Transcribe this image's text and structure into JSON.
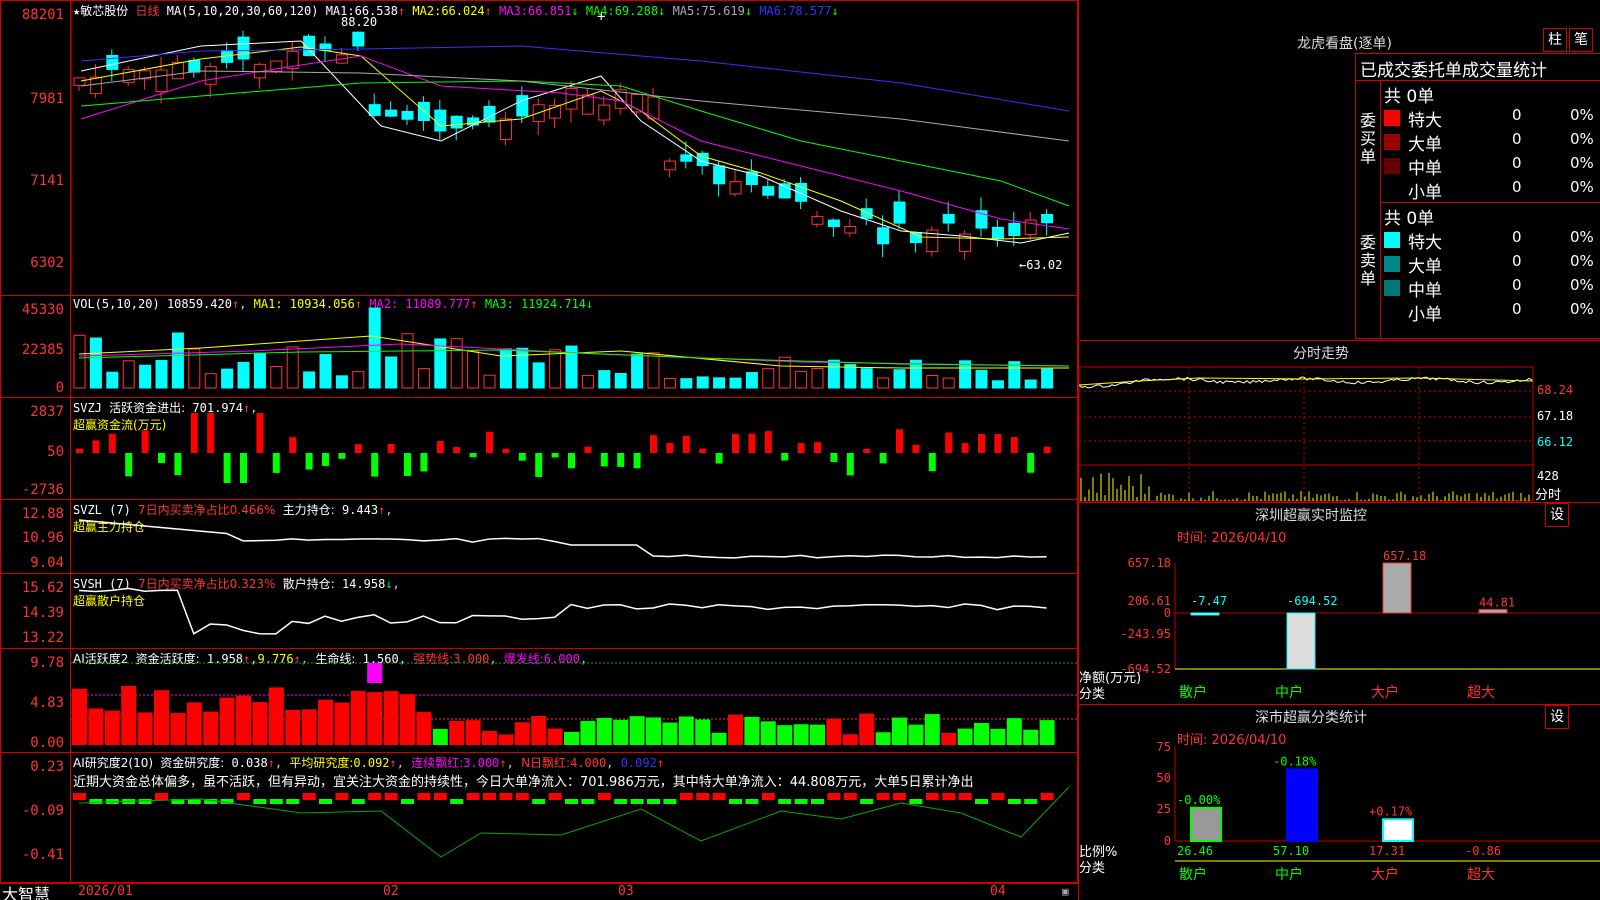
{
  "stock": {
    "star": "★",
    "name": "敏芯股份",
    "period": "日线",
    "ma_spec": "MA(5,10,20,30,60,120)",
    "ma": [
      {
        "k": "MA1:",
        "v": "66.538",
        "a": "↑",
        "c": "#fff"
      },
      {
        "k": "MA2:",
        "v": "66.024",
        "a": "↑",
        "c": "#ff0"
      },
      {
        "k": "MA3:",
        "v": "66.851",
        "a": "↓",
        "c": "#f0f"
      },
      {
        "k": "MA4:",
        "v": "69.288",
        "a": "↓",
        "c": "#0f0"
      },
      {
        "k": "MA5:",
        "v": "75.619",
        "a": "↓",
        "c": "#aaa"
      },
      {
        "k": "MA6:",
        "v": "78.577",
        "a": "↓",
        "c": "#33f"
      }
    ],
    "high_mark": "88.20",
    "low_mark": "←63.02"
  },
  "price_axis": [
    "88201",
    "7981",
    "7141",
    "6302"
  ],
  "vol": {
    "label": "VOL(5,10,20)",
    "val": "10859.420",
    "a": "↑",
    "ma": [
      {
        "k": "MA1:",
        "v": "10934.056",
        "a": "↑",
        "c": "#ff0"
      },
      {
        "k": "MA2:",
        "v": "11089.777",
        "a": "↑",
        "c": "#f0f"
      },
      {
        "k": "MA3:",
        "v": "11924.714",
        "a": "↓",
        "c": "#0f0"
      }
    ],
    "axis": [
      "45330",
      "22385",
      "0"
    ]
  },
  "svzj": {
    "label": "SVZJ",
    "title": "活跃资金进出:",
    "val": "701.974",
    "a": "↑",
    "sub": "超赢资金流(万元)",
    "axis": [
      "2837",
      "50",
      "-2736"
    ]
  },
  "svzl": {
    "label": "SVZL (7)",
    "t1": "7日内买卖净占比0.466%",
    "t2": "主力持仓:",
    "val": "9.443",
    "a": "↑",
    "sub": "超赢主力持仓",
    "axis": [
      "12.88",
      "10.96",
      "9.04"
    ]
  },
  "svsh": {
    "label": "SVSH (7)",
    "t1": "7日内买卖净占比0.323%",
    "t2": "散户持仓:",
    "val": "14.958",
    "a": "↓",
    "sub": "超赢散户持仓",
    "axis": [
      "15.62",
      "14.39",
      "13.22"
    ]
  },
  "ai1": {
    "label": "AI活跃度2",
    "t1": "资金活跃度:",
    "v1": "1.958",
    "v2": "9.776",
    "t3": "生命线:",
    "v3": "1.560",
    "t4": "强势线:",
    "v4": "3.000",
    "t5": "爆发线:",
    "v5": "6.000",
    "axis": [
      "9.78",
      "4.83",
      "0.00"
    ]
  },
  "ai2": {
    "label": "AI研究度2(10)",
    "t1": "资金研究度:",
    "v1": "0.038",
    "t2": "平均研究度:",
    "v2": "0.092",
    "t3": "连续飘红:",
    "v3": "3.000",
    "t4": "N日飘红:",
    "v4": "4.000",
    "v5": "0.092",
    "text": "近期大资金总体偏多，虽不活跃，但有异动，宜关注大资金的持续性，今日大单净流入：701.986万元，其中特大单净流入：44.808万元，大单5日累计净出",
    "axis": [
      "0.23",
      "-0.09",
      "-0.41"
    ]
  },
  "dates": [
    "2026/01",
    "02",
    "03",
    "04"
  ],
  "brand": "大智慧",
  "right": {
    "lhb_title": "龙虎看盘(逐单)",
    "btn1": "柱",
    "btn2": "笔",
    "table_title": "已成交委托单成交量统计",
    "buy": {
      "total": "共 0单",
      "side": "委买单",
      "rows": [
        {
          "label": "特大",
          "n": "0",
          "p": "0%",
          "c": "#f00"
        },
        {
          "label": "大单",
          "n": "0",
          "p": "0%",
          "c": "#900"
        },
        {
          "label": "中单",
          "n": "0",
          "p": "0%",
          "c": "#600"
        },
        {
          "label": "小单",
          "n": "0",
          "p": "0%",
          "c": "#000"
        }
      ]
    },
    "sell": {
      "total": "共 0单",
      "side": "委卖单",
      "rows": [
        {
          "label": "特大",
          "n": "0",
          "p": "0%",
          "c": "#0ff"
        },
        {
          "label": "大单",
          "n": "0",
          "p": "0%",
          "c": "#088"
        },
        {
          "label": "中单",
          "n": "0",
          "p": "0%",
          "c": "#077"
        },
        {
          "label": "小单",
          "n": "0",
          "p": "0%",
          "c": "#000"
        }
      ]
    },
    "fs_title": "分时走势",
    "fs_axis": [
      "68.24",
      "67.18",
      "66.12"
    ],
    "fs_vol": "428",
    "fs_bottom": "分时",
    "sz_title": "深圳超赢实时监控",
    "sz_btn": "设",
    "sz_time": "时间: 2026/04/10",
    "sz_axis": [
      "657.18",
      "206.61",
      "0",
      "-243.95",
      "-694.52"
    ],
    "sz_unit": "净额(万元)",
    "sz_cat": "分类",
    "cats": [
      "散户",
      "中户",
      "大户",
      "超大"
    ],
    "sz_vals": [
      "-7.47",
      "-694.52",
      "657.18",
      "44.81"
    ],
    "sc_title": "深市超赢分类统计",
    "sc_btn": "设",
    "sc_time": "时间: 2026/04/10",
    "sc_axis": [
      "75",
      "50",
      "25",
      "0"
    ],
    "sc_unit": "比例%",
    "sc_cat": "分类",
    "sc_pct": [
      "-0.00%",
      "-0.18%",
      "+0.17%",
      ""
    ],
    "sc_vals": [
      "26.46",
      "57.10",
      "17.31",
      "-0.86"
    ]
  }
}
